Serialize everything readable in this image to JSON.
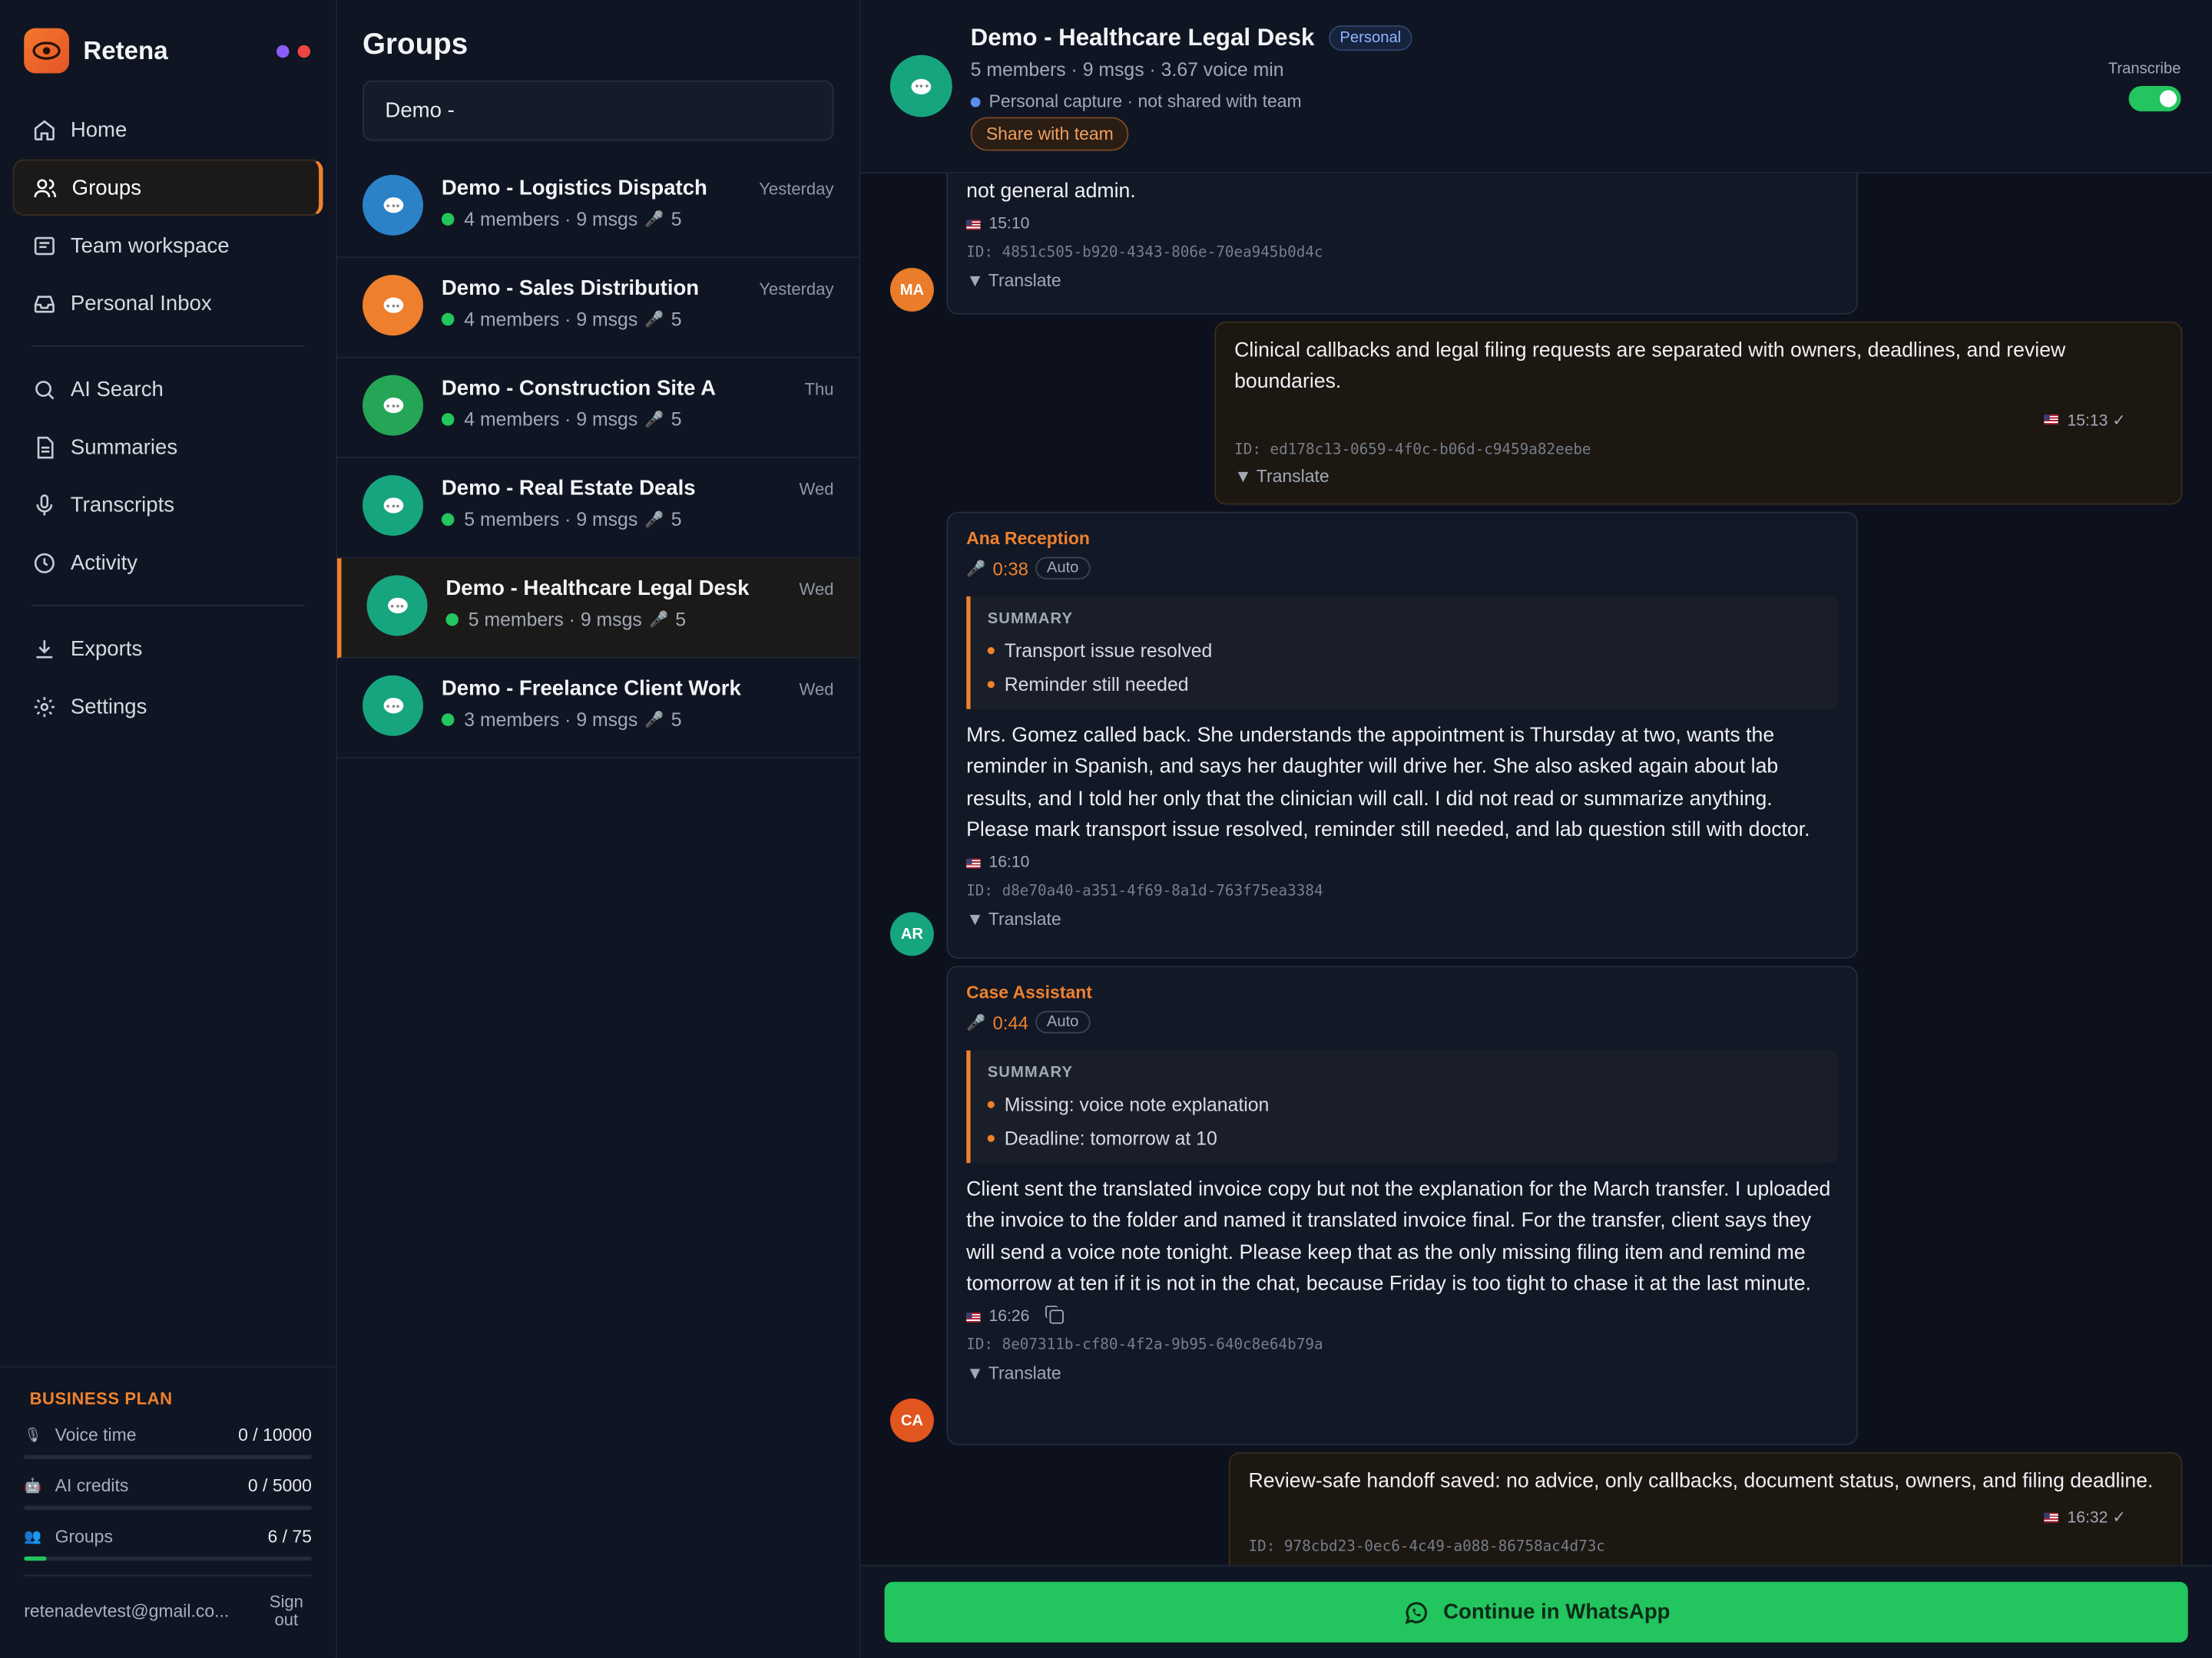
{
  "app": {
    "name": "Retena"
  },
  "sidebar": {
    "items": [
      {
        "label": "Home",
        "icon": "home-icon"
      },
      {
        "label": "Groups",
        "icon": "users-icon",
        "active": true
      },
      {
        "label": "Team workspace",
        "icon": "workspace-icon"
      },
      {
        "label": "Personal Inbox",
        "icon": "inbox-icon"
      },
      {
        "label": "AI Search",
        "icon": "search-icon"
      },
      {
        "label": "Summaries",
        "icon": "document-icon"
      },
      {
        "label": "Transcripts",
        "icon": "mic-icon"
      },
      {
        "label": "Activity",
        "icon": "clock-icon"
      },
      {
        "label": "Exports",
        "icon": "download-icon"
      },
      {
        "label": "Settings",
        "icon": "gear-icon"
      }
    ],
    "plan": {
      "title": "BUSINESS PLAN",
      "quotas": [
        {
          "label": "Voice time",
          "value": "0 / 10000",
          "fill": 0
        },
        {
          "label": "AI credits",
          "value": "0 / 5000",
          "fill": 0
        },
        {
          "label": "Groups",
          "value": "6 / 75",
          "fill": 0.08
        }
      ]
    },
    "user": {
      "email": "retenadevtest@gmail.co...",
      "signout": "Sign out"
    }
  },
  "groups": {
    "title": "Groups",
    "search_value": "Demo -",
    "items": [
      {
        "name": "Demo - Logistics Dispatch",
        "meta": "4 members · 9 msgs",
        "voice": "5",
        "time": "Yesterday",
        "color": "#2b82c7"
      },
      {
        "name": "Demo - Sales Distribution",
        "meta": "4 members · 9 msgs",
        "voice": "5",
        "time": "Yesterday",
        "color": "#ee7f2d"
      },
      {
        "name": "Demo - Construction Site A",
        "meta": "4 members · 9 msgs",
        "voice": "5",
        "time": "Thu",
        "color": "#24a656"
      },
      {
        "name": "Demo - Real Estate Deals",
        "meta": "5 members · 9 msgs",
        "voice": "5",
        "time": "Wed",
        "color": "#17a57f"
      },
      {
        "name": "Demo - Healthcare Legal Desk",
        "meta": "5 members · 9 msgs",
        "voice": "5",
        "time": "Wed",
        "color": "#17a57f",
        "active": true
      },
      {
        "name": "Demo - Freelance Client Work",
        "meta": "3 members · 9 msgs",
        "voice": "5",
        "time": "Wed",
        "color": "#17a57f"
      }
    ]
  },
  "chat": {
    "title": "Demo - Healthcare Legal Desk",
    "badge": "Personal",
    "subtitle": "5 members · 9 msgs · 3.67 voice min",
    "capture": "Personal capture · not shared with team",
    "share_label": "Share with team",
    "transcribe_label": "Transcribe",
    "transcribe_on": true,
    "messages": [
      {
        "text": "not general admin.",
        "time": "15:10",
        "id": "ID: 4851c505-b920-4343-806e-70ea945b0d4c",
        "translate": "Translate",
        "avatar": "MA"
      },
      {
        "text": "Clinical callbacks and legal filing requests are separated with owners, deadlines, and review boundaries.",
        "time": "15:13 ✓",
        "id": "ID: ed178c13-0659-4f0c-b06d-c9459a82eebe",
        "translate": "Translate"
      },
      {
        "sender": "Ana Reception",
        "duration": "0:38",
        "auto": "Auto",
        "summary_title": "SUMMARY",
        "summary": [
          "Transport issue resolved",
          "Reminder still needed"
        ],
        "text": "Mrs. Gomez called back. She understands the appointment is Thursday at two, wants the reminder in Spanish, and says her daughter will drive her. She also asked again about lab results, and I told her only that the clinician will call. I did not read or summarize anything. Please mark transport issue resolved, reminder still needed, and lab question still with doctor.",
        "time": "16:10",
        "id": "ID: d8e70a40-a351-4f69-8a1d-763f75ea3384",
        "translate": "Translate",
        "avatar": "AR"
      },
      {
        "sender": "Case Assistant",
        "duration": "0:44",
        "auto": "Auto",
        "summary_title": "SUMMARY",
        "summary": [
          "Missing: voice note explanation",
          "Deadline: tomorrow at 10"
        ],
        "text": "Client sent the translated invoice copy but not the explanation for the March transfer. I uploaded the invoice to the folder and named it translated invoice final. For the transfer, client says they will send a voice note tonight. Please keep that as the only missing filing item and remind me tomorrow at ten if it is not in the chat, because Friday is too tight to chase it at the last minute.",
        "time": "16:26",
        "id": "ID: 8e07311b-cf80-4f2a-9b95-640c8e64b79a",
        "translate": "Translate",
        "avatar": "CA"
      },
      {
        "text": "Review-safe handoff saved: no advice, only callbacks, document status, owners, and filing deadline.",
        "time": "16:32 ✓",
        "id": "ID: 978cbd23-0ec6-4c49-a088-86758ac4d73c"
      }
    ],
    "whatsapp_label": "Continue in WhatsApp"
  },
  "colors": {
    "accent": "#f0812d",
    "success": "#22c55e",
    "background": "#0c111d"
  }
}
